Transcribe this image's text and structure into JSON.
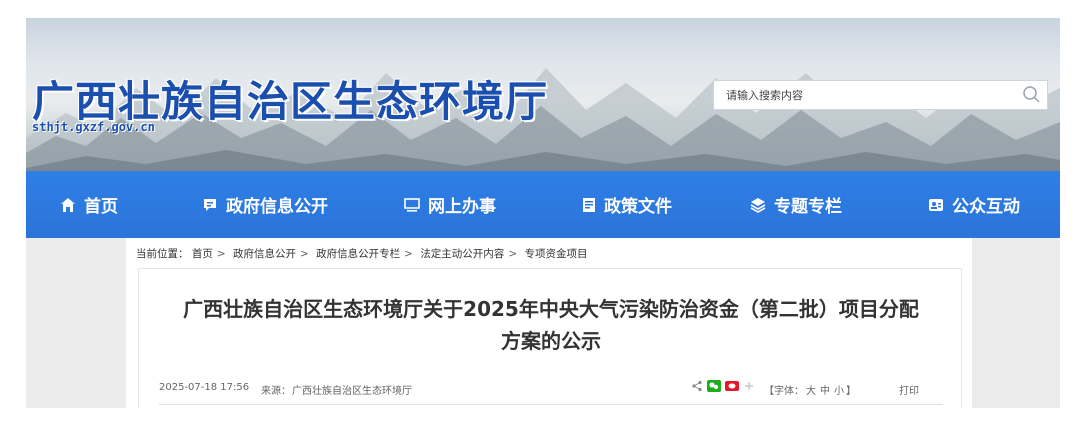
{
  "header": {
    "site_title": "广西壮族自治区生态环境厅",
    "site_domain": "sthjt.gxzf.gov.cn",
    "search_placeholder": "请输入搜索内容"
  },
  "nav": {
    "items": [
      {
        "label": "首页",
        "icon": "home-icon"
      },
      {
        "label": "政府信息公开",
        "icon": "chat-icon"
      },
      {
        "label": "网上办事",
        "icon": "monitor-icon"
      },
      {
        "label": "政策文件",
        "icon": "document-icon"
      },
      {
        "label": "专题专栏",
        "icon": "layers-icon"
      },
      {
        "label": "公众互动",
        "icon": "people-icon"
      }
    ]
  },
  "breadcrumb": {
    "prefix": "当前位置：",
    "items": [
      "首页",
      "政府信息公开",
      "政府信息公开专栏",
      "法定主动公开内容",
      "专项资金项目"
    ],
    "separator": ">"
  },
  "article": {
    "title_line1": "广西壮族自治区生态环境厅关于2025年中央大气污染防治资金（第二批）项目分配",
    "title_line2": "方案的公示",
    "date": "2025-07-18 17:56",
    "source_label": "来源：",
    "source": "广西壮族自治区生态环境厅",
    "font_size_open": "【字体：",
    "font_large": "大",
    "font_medium": "中",
    "font_small": "小",
    "font_size_close": "】",
    "print": "打印"
  },
  "colors": {
    "nav_blue": "#2a74da",
    "title_blue": "#1a4fb0",
    "wechat_green": "#1aad19",
    "weibo_red": "#e6162d"
  }
}
